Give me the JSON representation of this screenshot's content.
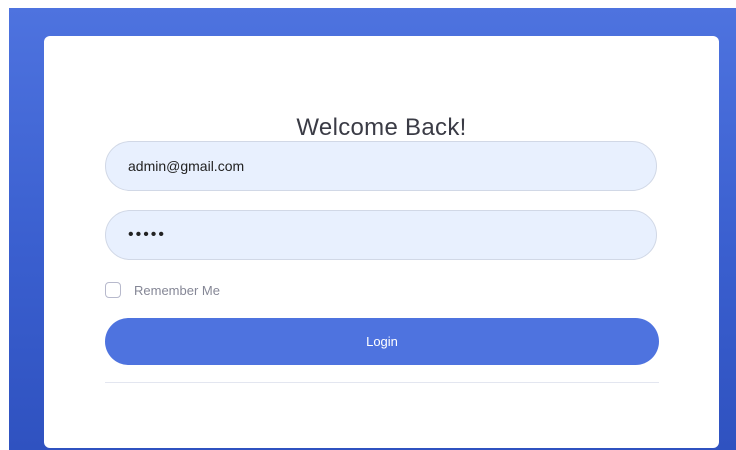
{
  "login": {
    "title": "Welcome Back!",
    "email_value": "admin@gmail.com",
    "password_value": "•••••",
    "remember_label": "Remember Me",
    "remember_checked": false,
    "login_label": "Login"
  },
  "colors": {
    "primary": "#4e73df",
    "input_background": "#e8f0fe",
    "card_background": "#ffffff"
  }
}
